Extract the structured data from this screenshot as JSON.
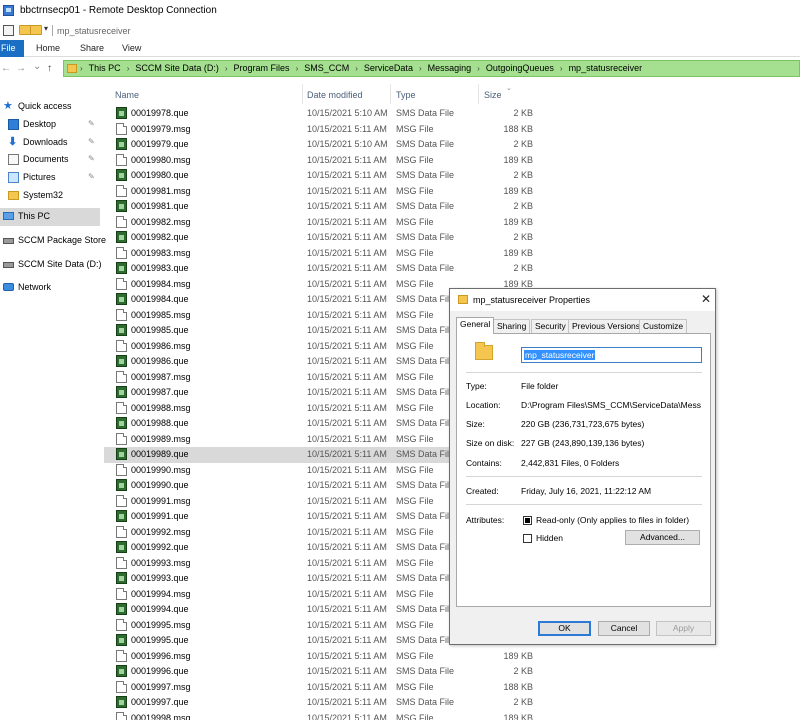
{
  "window": {
    "title": "bbctrnsecp01 - Remote Desktop Connection"
  },
  "explorer": {
    "qat_title": "mp_statusreceiver",
    "ribbon_tabs": [
      "File",
      "Home",
      "Share",
      "View"
    ],
    "address_crumbs": [
      "This PC",
      "SCCM Site Data (D:)",
      "Program Files",
      "SMS_CCM",
      "ServiceData",
      "Messaging",
      "OutgoingQueues",
      "mp_statusreceiver"
    ],
    "nav": {
      "back": "←",
      "forward": "→",
      "recent": "⌄",
      "up": "↑"
    },
    "sidebar": [
      {
        "label": "Quick access",
        "icon": "star-icon",
        "pinned": false
      },
      {
        "label": "Desktop",
        "icon": "desktop-icon",
        "pinned": true
      },
      {
        "label": "Downloads",
        "icon": "downloads-icon",
        "pinned": true
      },
      {
        "label": "Documents",
        "icon": "documents-icon",
        "pinned": true
      },
      {
        "label": "Pictures",
        "icon": "pictures-icon",
        "pinned": true
      },
      {
        "label": "System32",
        "icon": "folder-icon",
        "pinned": false
      },
      {
        "label": "This PC",
        "icon": "computer-icon",
        "pinned": false,
        "selected": true
      },
      {
        "label": "SCCM Package Store",
        "icon": "drive-icon",
        "pinned": false
      },
      {
        "label": "SCCM Site Data (D:)",
        "icon": "drive-icon",
        "pinned": false
      },
      {
        "label": "Network",
        "icon": "network-icon",
        "pinned": false
      }
    ],
    "columns": {
      "name": "Name",
      "date": "Date modified",
      "type": "Type",
      "size": "Size"
    },
    "files": [
      {
        "name": "00019978.que",
        "date": "10/15/2021 5:10 AM",
        "type": "SMS Data File",
        "size": "2 KB",
        "kind": "que"
      },
      {
        "name": "00019979.msg",
        "date": "10/15/2021 5:11 AM",
        "type": "MSG File",
        "size": "188 KB",
        "kind": "msg"
      },
      {
        "name": "00019979.que",
        "date": "10/15/2021 5:10 AM",
        "type": "SMS Data File",
        "size": "2 KB",
        "kind": "que"
      },
      {
        "name": "00019980.msg",
        "date": "10/15/2021 5:11 AM",
        "type": "MSG File",
        "size": "189 KB",
        "kind": "msg"
      },
      {
        "name": "00019980.que",
        "date": "10/15/2021 5:11 AM",
        "type": "SMS Data File",
        "size": "2 KB",
        "kind": "que"
      },
      {
        "name": "00019981.msg",
        "date": "10/15/2021 5:11 AM",
        "type": "MSG File",
        "size": "189 KB",
        "kind": "msg"
      },
      {
        "name": "00019981.que",
        "date": "10/15/2021 5:11 AM",
        "type": "SMS Data File",
        "size": "2 KB",
        "kind": "que"
      },
      {
        "name": "00019982.msg",
        "date": "10/15/2021 5:11 AM",
        "type": "MSG File",
        "size": "189 KB",
        "kind": "msg"
      },
      {
        "name": "00019982.que",
        "date": "10/15/2021 5:11 AM",
        "type": "SMS Data File",
        "size": "2 KB",
        "kind": "que"
      },
      {
        "name": "00019983.msg",
        "date": "10/15/2021 5:11 AM",
        "type": "MSG File",
        "size": "189 KB",
        "kind": "msg"
      },
      {
        "name": "00019983.que",
        "date": "10/15/2021 5:11 AM",
        "type": "SMS Data File",
        "size": "2 KB",
        "kind": "que"
      },
      {
        "name": "00019984.msg",
        "date": "10/15/2021 5:11 AM",
        "type": "MSG File",
        "size": "189 KB",
        "kind": "msg"
      },
      {
        "name": "00019984.que",
        "date": "10/15/2021 5:11 AM",
        "type": "SMS Data File",
        "size": "",
        "kind": "que"
      },
      {
        "name": "00019985.msg",
        "date": "10/15/2021 5:11 AM",
        "type": "MSG File",
        "size": "",
        "kind": "msg"
      },
      {
        "name": "00019985.que",
        "date": "10/15/2021 5:11 AM",
        "type": "SMS Data File",
        "size": "",
        "kind": "que"
      },
      {
        "name": "00019986.msg",
        "date": "10/15/2021 5:11 AM",
        "type": "MSG File",
        "size": "",
        "kind": "msg"
      },
      {
        "name": "00019986.que",
        "date": "10/15/2021 5:11 AM",
        "type": "SMS Data File",
        "size": "",
        "kind": "que"
      },
      {
        "name": "00019987.msg",
        "date": "10/15/2021 5:11 AM",
        "type": "MSG File",
        "size": "",
        "kind": "msg"
      },
      {
        "name": "00019987.que",
        "date": "10/15/2021 5:11 AM",
        "type": "SMS Data File",
        "size": "",
        "kind": "que"
      },
      {
        "name": "00019988.msg",
        "date": "10/15/2021 5:11 AM",
        "type": "MSG File",
        "size": "",
        "kind": "msg"
      },
      {
        "name": "00019988.que",
        "date": "10/15/2021 5:11 AM",
        "type": "SMS Data File",
        "size": "",
        "kind": "que"
      },
      {
        "name": "00019989.msg",
        "date": "10/15/2021 5:11 AM",
        "type": "MSG File",
        "size": "",
        "kind": "msg"
      },
      {
        "name": "00019989.que",
        "date": "10/15/2021 5:11 AM",
        "type": "SMS Data File",
        "size": "",
        "kind": "que",
        "selected": true
      },
      {
        "name": "00019990.msg",
        "date": "10/15/2021 5:11 AM",
        "type": "MSG File",
        "size": "",
        "kind": "msg"
      },
      {
        "name": "00019990.que",
        "date": "10/15/2021 5:11 AM",
        "type": "SMS Data File",
        "size": "",
        "kind": "que"
      },
      {
        "name": "00019991.msg",
        "date": "10/15/2021 5:11 AM",
        "type": "MSG File",
        "size": "",
        "kind": "msg"
      },
      {
        "name": "00019991.que",
        "date": "10/15/2021 5:11 AM",
        "type": "SMS Data File",
        "size": "",
        "kind": "que"
      },
      {
        "name": "00019992.msg",
        "date": "10/15/2021 5:11 AM",
        "type": "MSG File",
        "size": "",
        "kind": "msg"
      },
      {
        "name": "00019992.que",
        "date": "10/15/2021 5:11 AM",
        "type": "SMS Data File",
        "size": "",
        "kind": "que"
      },
      {
        "name": "00019993.msg",
        "date": "10/15/2021 5:11 AM",
        "type": "MSG File",
        "size": "",
        "kind": "msg"
      },
      {
        "name": "00019993.que",
        "date": "10/15/2021 5:11 AM",
        "type": "SMS Data File",
        "size": "",
        "kind": "que"
      },
      {
        "name": "00019994.msg",
        "date": "10/15/2021 5:11 AM",
        "type": "MSG File",
        "size": "",
        "kind": "msg"
      },
      {
        "name": "00019994.que",
        "date": "10/15/2021 5:11 AM",
        "type": "SMS Data File",
        "size": "",
        "kind": "que"
      },
      {
        "name": "00019995.msg",
        "date": "10/15/2021 5:11 AM",
        "type": "MSG File",
        "size": "",
        "kind": "msg"
      },
      {
        "name": "00019995.que",
        "date": "10/15/2021 5:11 AM",
        "type": "SMS Data File",
        "size": "",
        "kind": "que"
      },
      {
        "name": "00019996.msg",
        "date": "10/15/2021 5:11 AM",
        "type": "MSG File",
        "size": "189 KB",
        "kind": "msg"
      },
      {
        "name": "00019996.que",
        "date": "10/15/2021 5:11 AM",
        "type": "SMS Data File",
        "size": "2 KB",
        "kind": "que"
      },
      {
        "name": "00019997.msg",
        "date": "10/15/2021 5:11 AM",
        "type": "MSG File",
        "size": "188 KB",
        "kind": "msg"
      },
      {
        "name": "00019997.que",
        "date": "10/15/2021 5:11 AM",
        "type": "SMS Data File",
        "size": "2 KB",
        "kind": "que"
      },
      {
        "name": "00019998.msg",
        "date": "10/15/2021 5:11 AM",
        "type": "MSG File",
        "size": "189 KB",
        "kind": "msg"
      }
    ]
  },
  "properties_dialog": {
    "title": "mp_statusreceiver Properties",
    "close": "✕",
    "tabs": [
      "General",
      "Sharing",
      "Security",
      "Previous Versions",
      "Customize"
    ],
    "active_tab": "General",
    "name": "mp_statusreceiver",
    "type_label": "Type:",
    "type_value": "File folder",
    "location_label": "Location:",
    "location_value": "D:\\Program Files\\SMS_CCM\\ServiceData\\Messaging\\OutgoingQueues",
    "size_label": "Size:",
    "size_value": "220 GB (236,731,723,675 bytes)",
    "size_on_disk_label": "Size on disk:",
    "size_on_disk_value": "227 GB (243,890,139,136 bytes)",
    "contains_label": "Contains:",
    "contains_value": "2,442,831 Files, 0 Folders",
    "created_label": "Created:",
    "created_value": "Friday, July 16, 2021, 11:22:12 AM",
    "attributes_label": "Attributes:",
    "readonly_label": "Read-only (Only applies to files in folder)",
    "readonly_checked": true,
    "hidden_label": "Hidden",
    "hidden_checked": false,
    "advanced_button": "Advanced...",
    "ok_button": "OK",
    "cancel_button": "Cancel",
    "apply_button": "Apply"
  },
  "colors": {
    "address_bar": "#a4e08f",
    "file_tab": "#1a6fc4",
    "selection": "#d9d9d9",
    "default_button_border": "#2d7ad6"
  }
}
